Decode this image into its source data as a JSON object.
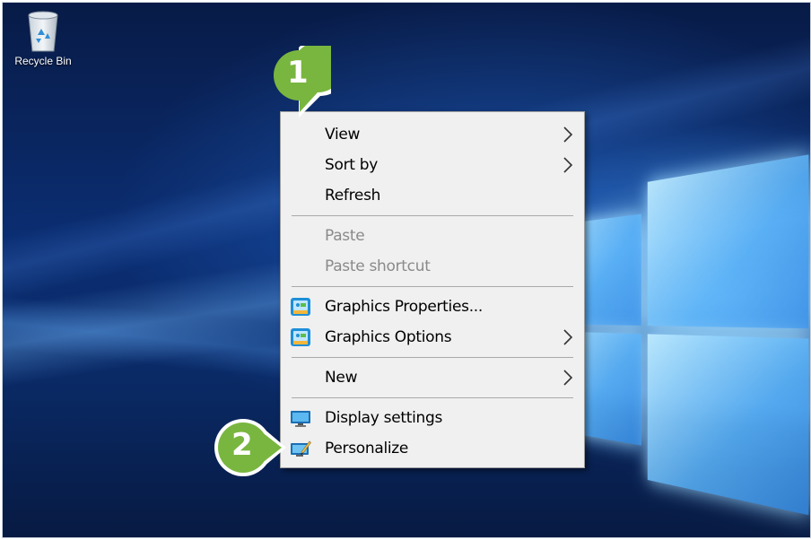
{
  "desktop": {
    "icons": [
      {
        "label": "Recycle Bin",
        "icon": "recycle-bin-icon"
      }
    ]
  },
  "context_menu": {
    "items": [
      {
        "label": "View",
        "has_submenu": true,
        "enabled": true
      },
      {
        "label": "Sort by",
        "has_submenu": true,
        "enabled": true
      },
      {
        "label": "Refresh",
        "has_submenu": false,
        "enabled": true
      },
      {
        "label": "Paste",
        "has_submenu": false,
        "enabled": false
      },
      {
        "label": "Paste shortcut",
        "has_submenu": false,
        "enabled": false
      },
      {
        "label": "Graphics Properties...",
        "has_submenu": false,
        "enabled": true,
        "icon": "intel-graphics-icon"
      },
      {
        "label": "Graphics Options",
        "has_submenu": true,
        "enabled": true,
        "icon": "intel-graphics-icon"
      },
      {
        "label": "New",
        "has_submenu": true,
        "enabled": true
      },
      {
        "label": "Display settings",
        "has_submenu": false,
        "enabled": true,
        "icon": "display-monitor-icon"
      },
      {
        "label": "Personalize",
        "has_submenu": false,
        "enabled": true,
        "icon": "personalize-icon"
      }
    ]
  },
  "callouts": [
    {
      "number": "1"
    },
    {
      "number": "2"
    }
  ],
  "colors": {
    "callout_green": "#79b63f",
    "menu_bg": "#f0f0f0",
    "disabled_text": "#8a8a8a"
  }
}
